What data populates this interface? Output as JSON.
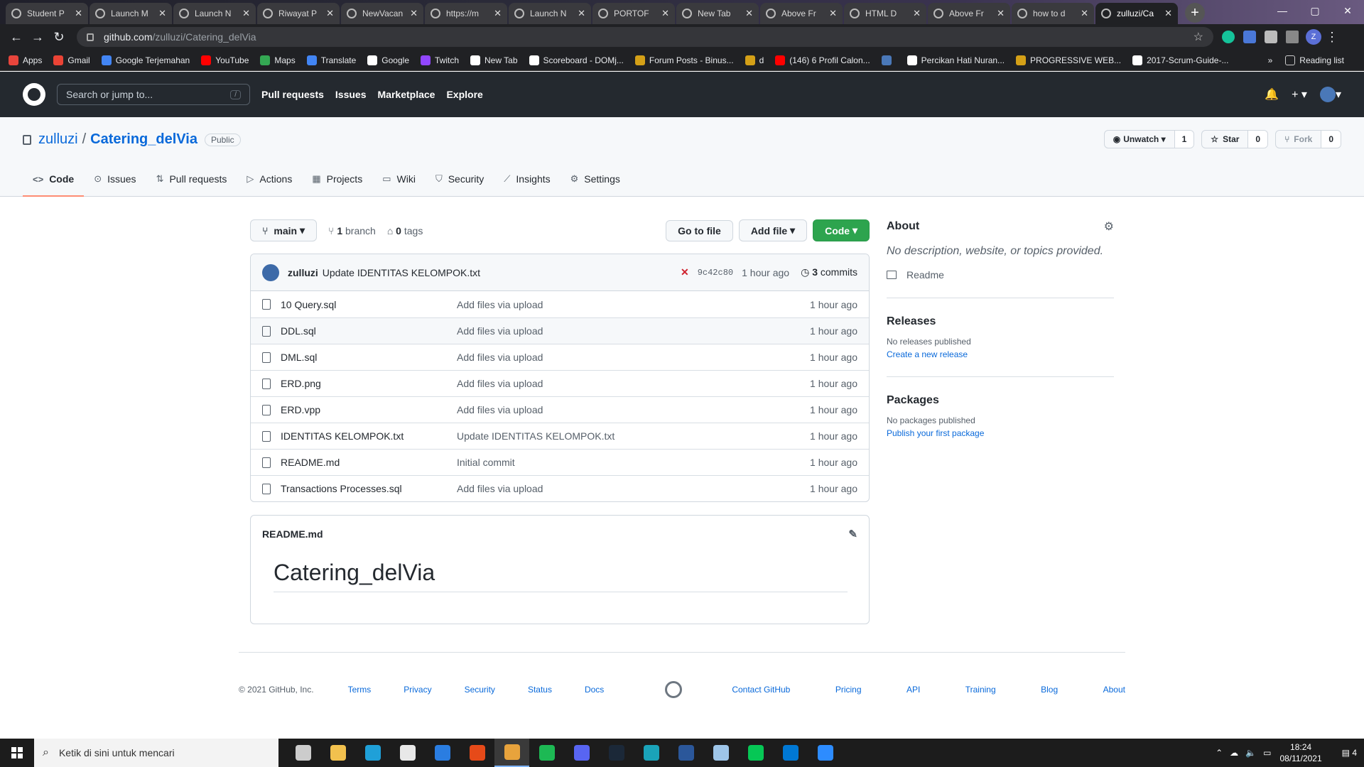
{
  "browser": {
    "tabs": [
      {
        "title": "Student P"
      },
      {
        "title": "Launch M"
      },
      {
        "title": "Launch N"
      },
      {
        "title": "Riwayat P"
      },
      {
        "title": "NewVacan"
      },
      {
        "title": "https://m"
      },
      {
        "title": "Launch N"
      },
      {
        "title": "PORTOF"
      },
      {
        "title": "New Tab"
      },
      {
        "title": "Above Fr"
      },
      {
        "title": "HTML D"
      },
      {
        "title": "Above Fr"
      },
      {
        "title": "how to d"
      },
      {
        "title": "zulluzi/Ca",
        "active": true
      }
    ],
    "url_host": "github.com",
    "url_path": "/zulluzi/Catering_delVia",
    "profile_initial": "Z",
    "bookmarks": [
      {
        "label": "Apps",
        "color": "#e8453c"
      },
      {
        "label": "Gmail",
        "color": "#ea4335"
      },
      {
        "label": "Google Terjemahan",
        "color": "#4285f4"
      },
      {
        "label": "YouTube",
        "color": "#ff0000"
      },
      {
        "label": "Maps",
        "color": "#34a853"
      },
      {
        "label": "Translate",
        "color": "#4285f4"
      },
      {
        "label": "Google",
        "color": "#ffffff"
      },
      {
        "label": "Twitch",
        "color": "#9146ff"
      },
      {
        "label": "New Tab",
        "color": "#ffffff"
      },
      {
        "label": "Scoreboard - DOMj...",
        "color": "#ffffff"
      },
      {
        "label": "Forum Posts - Binus...",
        "color": "#d4a017"
      },
      {
        "label": "d",
        "color": "#d4a017"
      },
      {
        "label": "(146) 6 Profil Calon...",
        "color": "#ff0000"
      },
      {
        "label": "",
        "color": "#4a78b8"
      },
      {
        "label": "Percikan Hati Nuran...",
        "color": "#ffffff"
      },
      {
        "label": "PROGRESSIVE WEB...",
        "color": "#d4a017"
      },
      {
        "label": "2017-Scrum-Guide-...",
        "color": "#ffffff"
      }
    ],
    "more_label": "»",
    "reading_list": "Reading list"
  },
  "github": {
    "search_placeholder": "Search or jump to...",
    "search_key": "/",
    "nav": [
      "Pull requests",
      "Issues",
      "Marketplace",
      "Explore"
    ],
    "repo": {
      "owner": "zulluzi",
      "separator": "/",
      "name": "Catering_delVia",
      "visibility": "Public",
      "watch_label": "Unwatch",
      "watch_count": "1",
      "star_label": "Star",
      "star_count": "0",
      "fork_label": "Fork",
      "fork_count": "0"
    },
    "tabs": [
      {
        "label": "Code",
        "icon": "<>",
        "active": true
      },
      {
        "label": "Issues",
        "icon": "⊙"
      },
      {
        "label": "Pull requests",
        "icon": "⇅"
      },
      {
        "label": "Actions",
        "icon": "▷"
      },
      {
        "label": "Projects",
        "icon": "▦"
      },
      {
        "label": "Wiki",
        "icon": "▭"
      },
      {
        "label": "Security",
        "icon": "⛉"
      },
      {
        "label": "Insights",
        "icon": "⟋"
      },
      {
        "label": "Settings",
        "icon": "⚙"
      }
    ],
    "filebar": {
      "branch": "main",
      "branch_count": "1",
      "branch_word": "branch",
      "tag_count": "0",
      "tag_word": "tags",
      "goto_file": "Go to file",
      "add_file": "Add file",
      "code": "Code"
    },
    "commit": {
      "author": "zulluzi",
      "message": "Update IDENTITAS KELOMPOK.txt",
      "status": "✕",
      "sha": "9c42c80",
      "ago": "1 hour ago",
      "commit_count": "3",
      "commit_word": "commits"
    },
    "files": [
      {
        "name": "10 Query.sql",
        "message": "Add files via upload",
        "age": "1 hour ago"
      },
      {
        "name": "DDL.sql",
        "message": "Add files via upload",
        "age": "1 hour ago"
      },
      {
        "name": "DML.sql",
        "message": "Add files via upload",
        "age": "1 hour ago"
      },
      {
        "name": "ERD.png",
        "message": "Add files via upload",
        "age": "1 hour ago"
      },
      {
        "name": "ERD.vpp",
        "message": "Add files via upload",
        "age": "1 hour ago"
      },
      {
        "name": "IDENTITAS KELOMPOK.txt",
        "message": "Update IDENTITAS KELOMPOK.txt",
        "age": "1 hour ago"
      },
      {
        "name": "README.md",
        "message": "Initial commit",
        "age": "1 hour ago"
      },
      {
        "name": "Transactions Processes.sql",
        "message": "Add files via upload",
        "age": "1 hour ago"
      }
    ],
    "readme": {
      "filename": "README.md",
      "heading": "Catering_delVia"
    },
    "about": {
      "title": "About",
      "description": "No description, website, or topics provided.",
      "readme_link": "Readme",
      "releases_title": "Releases",
      "releases_text": "No releases published",
      "releases_link": "Create a new release",
      "packages_title": "Packages",
      "packages_text": "No packages published",
      "packages_link": "Publish your first package"
    },
    "footer": {
      "copyright": "© 2021 GitHub, Inc.",
      "left_links": [
        "Terms",
        "Privacy",
        "Security",
        "Status",
        "Docs"
      ],
      "right_links": [
        "Contact GitHub",
        "Pricing",
        "API",
        "Training",
        "Blog",
        "About"
      ]
    }
  },
  "taskbar": {
    "search_placeholder": "Ketik di sini untuk mencari",
    "apps": [
      {
        "name": "task-view",
        "color": "#cccccc"
      },
      {
        "name": "file-explorer",
        "color": "#f2c14e"
      },
      {
        "name": "edge",
        "color": "#1fa0d8"
      },
      {
        "name": "store",
        "color": "#e8e8e8"
      },
      {
        "name": "mail",
        "color": "#2a7de1"
      },
      {
        "name": "office",
        "color": "#e64a19"
      },
      {
        "name": "chrome",
        "color": "#e8a33c",
        "active": true
      },
      {
        "name": "spotify",
        "color": "#1db954"
      },
      {
        "name": "discord",
        "color": "#5865f2"
      },
      {
        "name": "steam",
        "color": "#1b2838"
      },
      {
        "name": "edge-dev",
        "color": "#1aa3b9"
      },
      {
        "name": "word",
        "color": "#2b579a"
      },
      {
        "name": "notes",
        "color": "#9ec5e8"
      },
      {
        "name": "line",
        "color": "#06c755"
      },
      {
        "name": "vscode",
        "color": "#0078d4"
      },
      {
        "name": "zoom",
        "color": "#2d8cff"
      }
    ],
    "time": "18:24",
    "date": "08/11/2021",
    "notification_count": "4"
  }
}
